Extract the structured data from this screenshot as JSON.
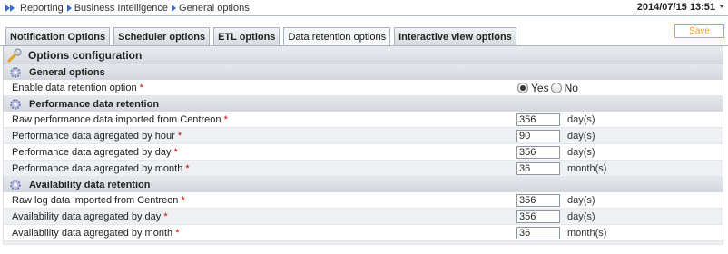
{
  "breadcrumb": [
    "Reporting",
    "Business Intelligence",
    "General options"
  ],
  "datetime": "2014/07/15 13:51",
  "tabs": [
    {
      "label": "Notification Options",
      "active": false
    },
    {
      "label": "Scheduler options",
      "active": false
    },
    {
      "label": "ETL options",
      "active": false
    },
    {
      "label": "Data retention options",
      "active": true
    },
    {
      "label": "Interactive view options",
      "active": false
    }
  ],
  "save_label": "Save",
  "panel_title": "Options configuration",
  "required_mark": "*",
  "sections": {
    "general": {
      "title": "General options",
      "enable_label": "Enable data retention option",
      "yes_label": "Yes",
      "no_label": "No",
      "selected": "Yes"
    },
    "performance": {
      "title": "Performance data retention",
      "rows": [
        {
          "label": "Raw performance data imported from Centreon",
          "value": "356",
          "unit": "day(s)"
        },
        {
          "label": "Performance data agregated by hour",
          "value": "90",
          "unit": "day(s)"
        },
        {
          "label": "Performance data agregated by day",
          "value": "356",
          "unit": "day(s)"
        },
        {
          "label": "Performance data agregated by month",
          "value": "36",
          "unit": "month(s)"
        }
      ]
    },
    "availability": {
      "title": "Availability data retention",
      "rows": [
        {
          "label": "Raw log data imported from Centreon",
          "value": "356",
          "unit": "day(s)"
        },
        {
          "label": "Availability data agregated by day",
          "value": "356",
          "unit": "day(s)"
        },
        {
          "label": "Availability data agregated by month",
          "value": "36",
          "unit": "month(s)"
        }
      ]
    }
  },
  "colors": {
    "breadcrumb_arrow": "#3a6cc2",
    "save_button": "#f0a020",
    "required": "#d40000"
  }
}
